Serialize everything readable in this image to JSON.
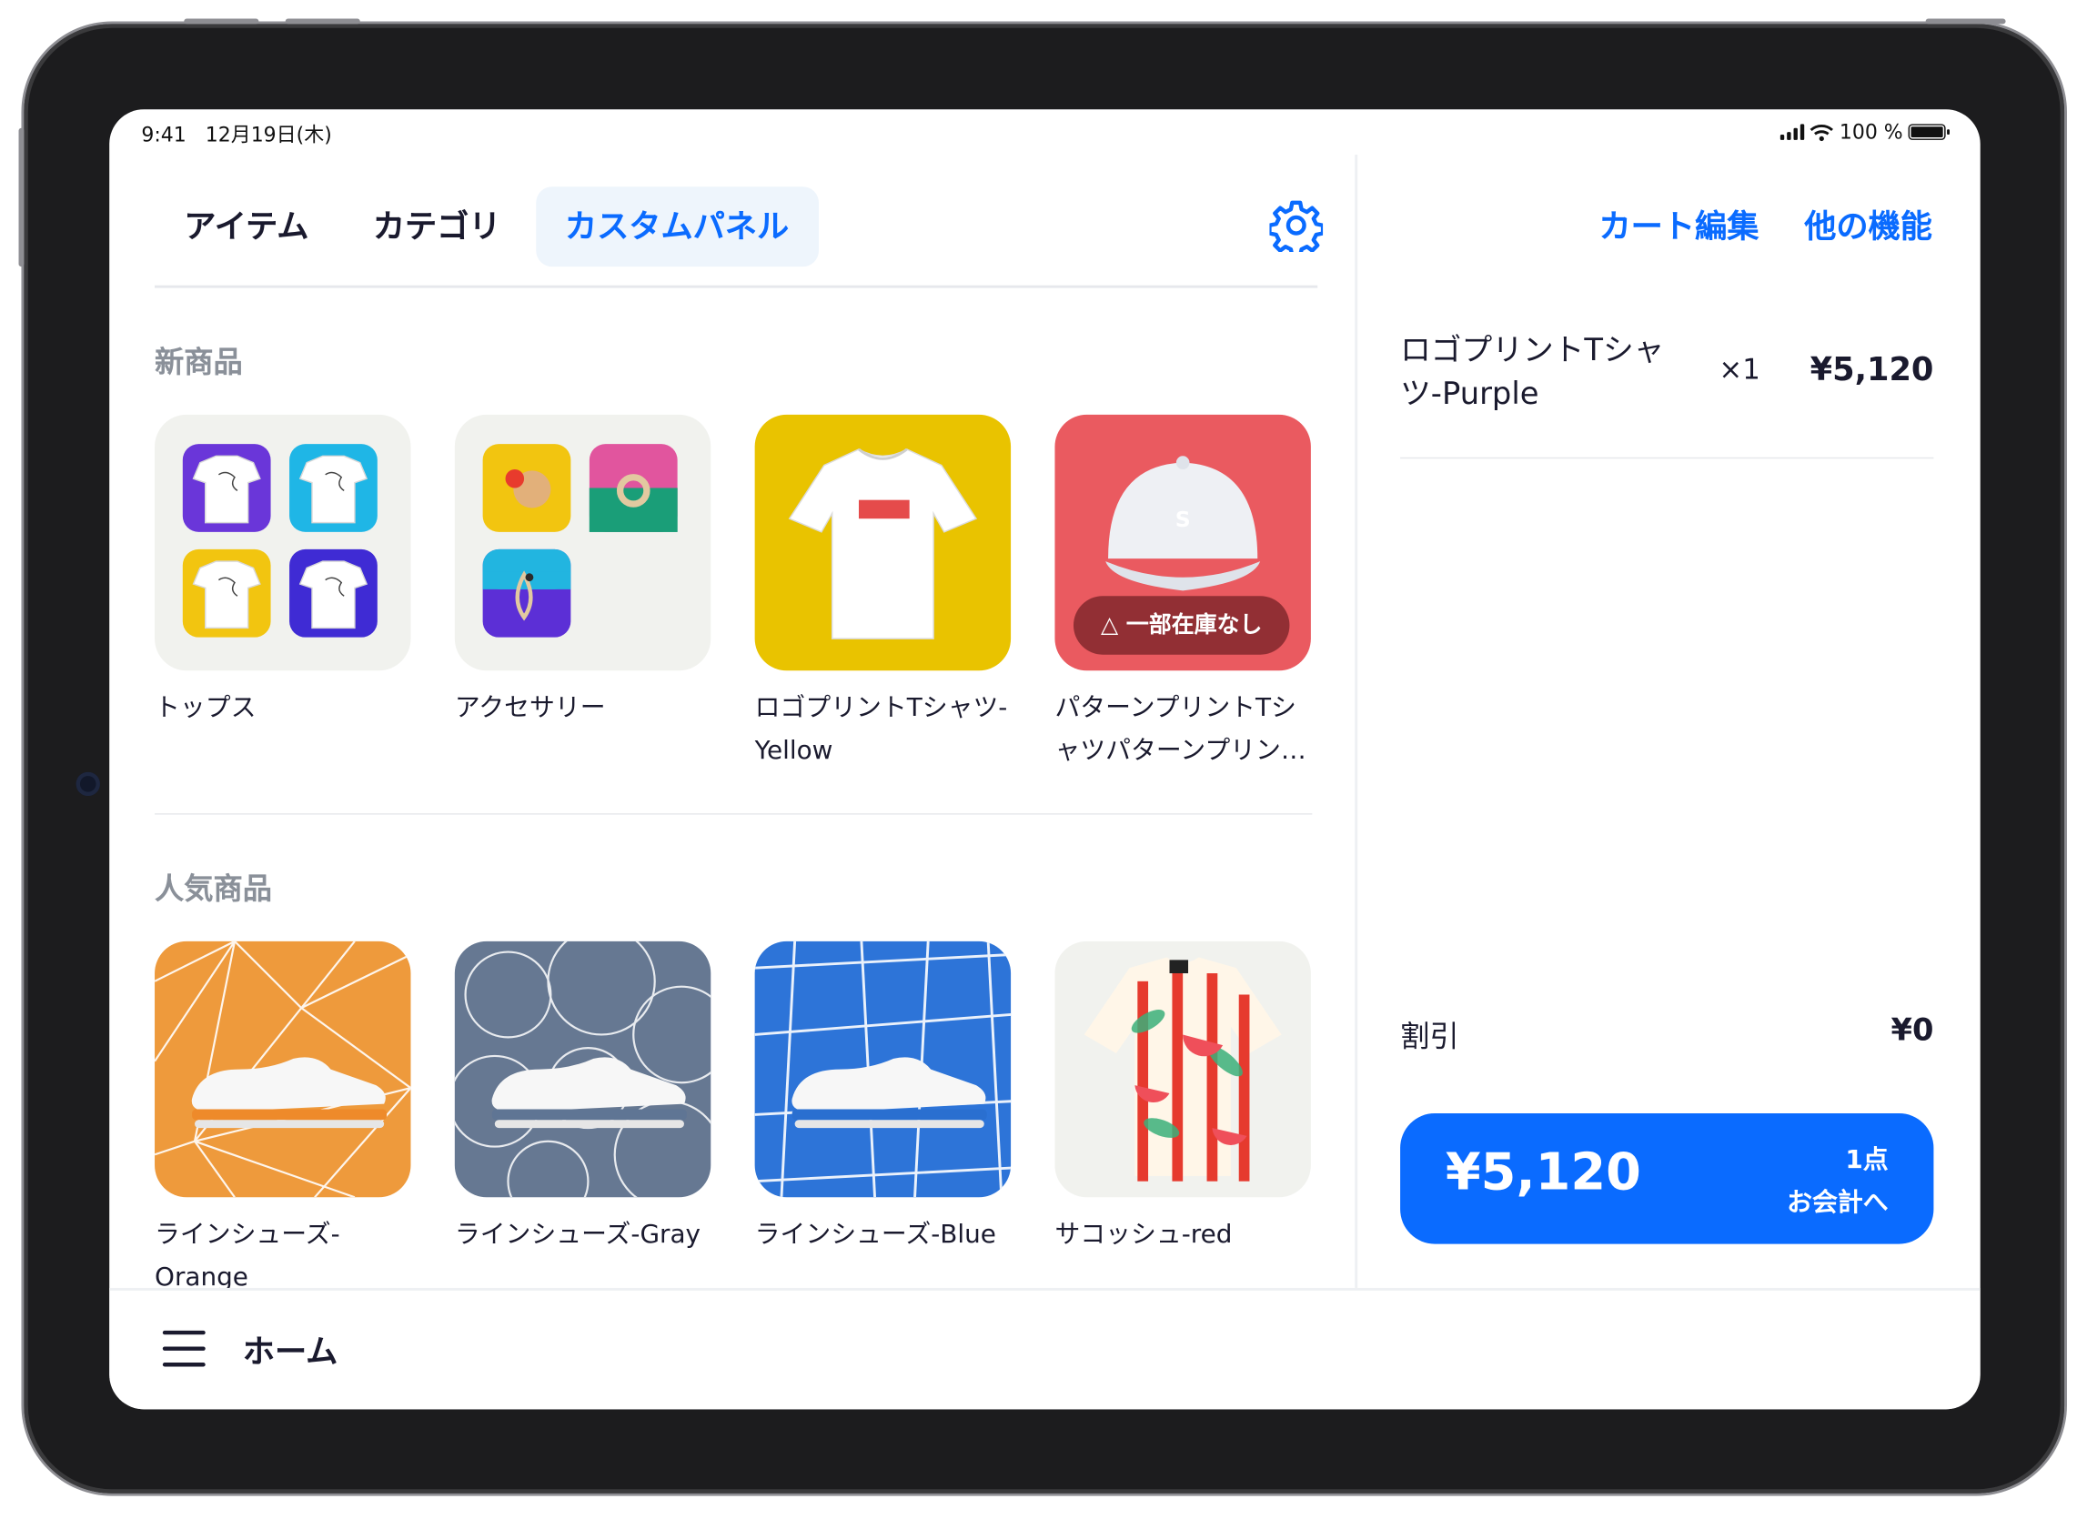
{
  "status_bar": {
    "time": "9:41",
    "date": "12月19日(木)",
    "battery_text": "100 %",
    "icons": [
      "cellular-signal-icon",
      "wifi-icon",
      "battery-icon"
    ]
  },
  "tabs": [
    {
      "label": "アイテム",
      "active": false
    },
    {
      "label": "カテゴリ",
      "active": false
    },
    {
      "label": "カスタムパネル",
      "active": true
    }
  ],
  "settings_icon": "gear-icon",
  "sections": {
    "new_products": {
      "title": "新商品",
      "items": [
        {
          "name": "トップス",
          "thumbnail": "tops-folder-grid"
        },
        {
          "name": "アクセサリー",
          "thumbnail": "accessory-folder-grid"
        },
        {
          "name": "ロゴプリントTシャツ-Yellow",
          "thumbnail": "tshirt-on-yellow"
        },
        {
          "name": "パターンプリントTシャツパターンプリントTシャツ",
          "thumbnail": "cap-on-red",
          "badge": "一部在庫なし"
        }
      ]
    },
    "popular_products": {
      "title": "人気商品",
      "items": [
        {
          "name": "ラインシューズ-Orange",
          "thumbnail": "shoe-on-orange"
        },
        {
          "name": "ラインシューズ-Gray",
          "thumbnail": "shoe-on-gray"
        },
        {
          "name": "ラインシューズ-Blue",
          "thumbnail": "shoe-on-blue"
        },
        {
          "name": "サコッシュ-red",
          "thumbnail": "aloha-shirt"
        }
      ]
    }
  },
  "cart": {
    "actions": {
      "edit": "カート編集",
      "more": "他の機能"
    },
    "items": [
      {
        "name": "ロゴプリントTシャツ-Purple",
        "qty": "×1",
        "price": "¥5,120"
      }
    ],
    "discount_label": "割引",
    "discount_value": "¥0",
    "checkout": {
      "total": "¥5,120",
      "count": "1点",
      "label": "お会計へ"
    }
  },
  "bottom_bar": {
    "menu_icon": "hamburger-menu-icon",
    "title": "ホーム"
  },
  "colors": {
    "accent": "#0a6bff",
    "tab_active_bg": "#eef5fc",
    "section_title": "#8a9099",
    "badge_bg": "#82282d"
  }
}
